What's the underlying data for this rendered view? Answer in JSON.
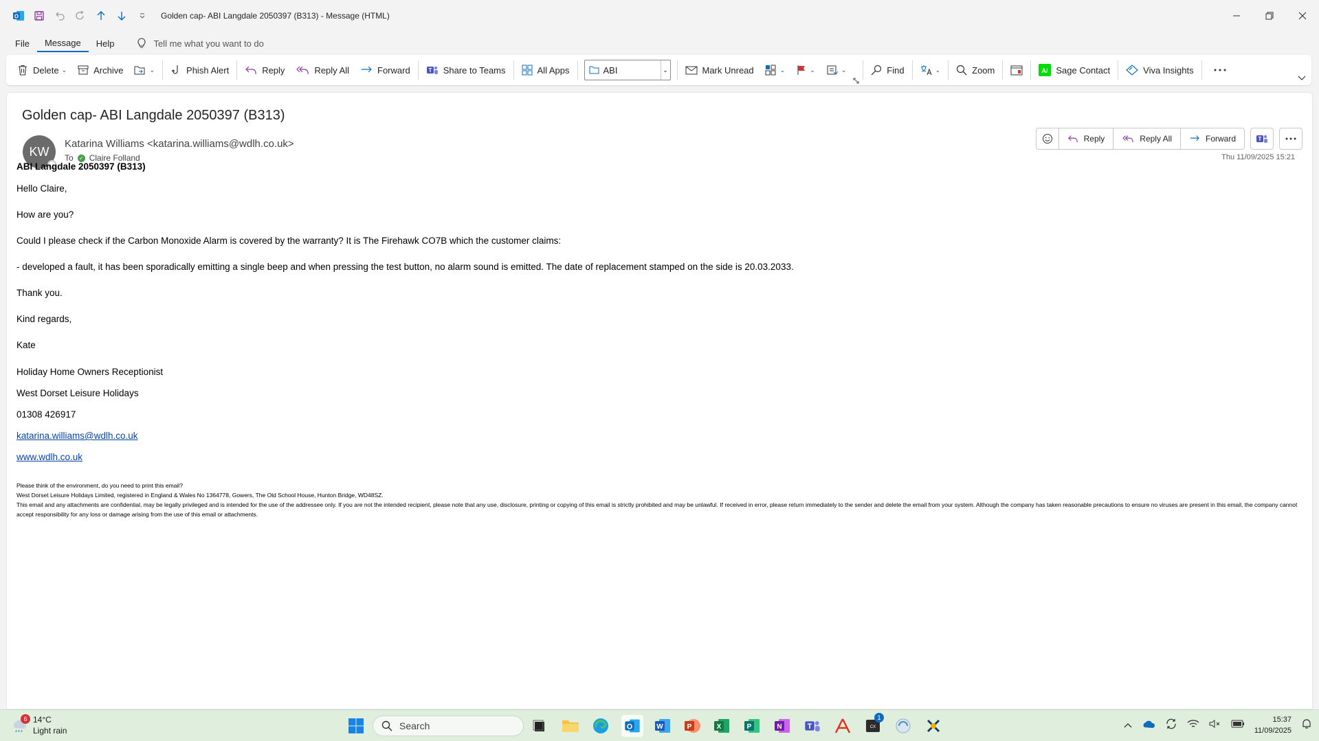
{
  "window": {
    "title": "Golden cap- ABI Langdale 2050397 (B313)  -  Message (HTML)"
  },
  "menu": {
    "tabs": [
      "File",
      "Message",
      "Help"
    ],
    "tellme": "Tell me what you want to do"
  },
  "ribbon": {
    "delete": "Delete",
    "archive": "Archive",
    "phish_alert": "Phish Alert",
    "reply": "Reply",
    "reply_all": "Reply All",
    "forward": "Forward",
    "share_teams": "Share to Teams",
    "all_apps": "All Apps",
    "category": "ABI",
    "mark_unread": "Mark Unread",
    "find": "Find",
    "zoom": "Zoom",
    "sage_contact": "Sage Contact",
    "viva_insights": "Viva Insights"
  },
  "message": {
    "subject": "Golden cap- ABI Langdale 2050397 (B313)",
    "avatar_initials": "KW",
    "from": "Katarina Williams <katarina.williams@wdlh.co.uk>",
    "to_label": "To",
    "to": "Claire Folland",
    "datetime": "Thu 11/09/2025 15:21",
    "actions": {
      "reply": "Reply",
      "reply_all": "Reply All",
      "forward": "Forward"
    },
    "body": {
      "heading": "ABI Langdale 2050397 (B313)",
      "greeting": "Hello Claire,",
      "line1": "How are you?",
      "line2": "Could I please check if the Carbon Monoxide Alarm is covered by the warranty? It is The Firehawk CO7B which the customer claims:",
      "line3": "- developed a fault, it has been sporadically emitting a single beep and when pressing the test button, no alarm sound is emitted. The date of replacement stamped on the side is 20.03.2033.",
      "thanks": "Thank you.",
      "regards": "Kind regards,",
      "name": "Kate",
      "sig_title": "Holiday Home Owners Receptionist",
      "sig_company": "West Dorset Leisure Holidays",
      "sig_phone": "01308 426917",
      "sig_email": "katarina.williams@wdlh.co.uk",
      "sig_web": "www.wdlh.co.uk",
      "footer1": "Please think of the environment, do you need to print this email?",
      "footer2": "West Dorset Leisure Holidays Limited, registered in England & Wales No 1364778, Gowers, The Old School House, Hunton Bridge, WD48SZ.",
      "footer3": "This email and any attachments are confidential, may be legally privileged and is intended for the use of the addressee only. If you are not the intended recipient, please note that any use, disclosure, printing or copying of this email is strictly prohibited and may be unlawful. If received in error, please return immediately to the sender and delete the email from your system. Although the company has taken reasonable precautions to ensure no viruses are present in this email, the company cannot accept responsibility for any loss or damage arising from the use of this email or attachments."
    }
  },
  "taskbar": {
    "weather_temp": "14°C",
    "weather_desc": "Light rain",
    "weather_badge": "6",
    "search": "Search",
    "teams_badge": "1",
    "time": "15:37",
    "date": "11/09/2025"
  }
}
